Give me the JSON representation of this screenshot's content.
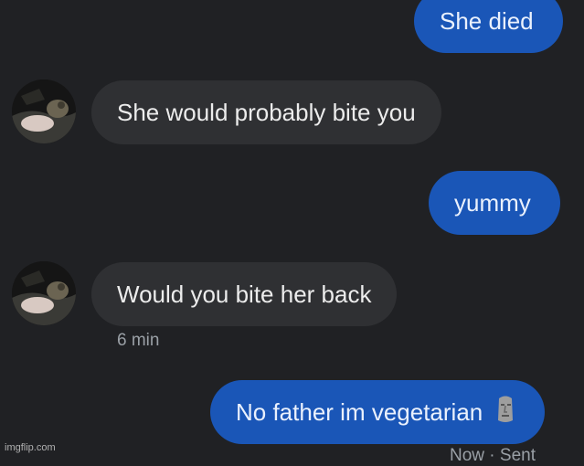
{
  "conversation": {
    "messages": [
      {
        "direction": "sent",
        "text": "She died"
      },
      {
        "direction": "received",
        "text": "She would probably bite you"
      },
      {
        "direction": "sent",
        "text": "yummy"
      },
      {
        "direction": "received",
        "text": "Would you bite her back",
        "timestamp": "6 min"
      },
      {
        "direction": "sent",
        "text": "No father im vegetarian",
        "emoji_icon": "moai-icon",
        "status": "Now · Sent"
      }
    ]
  },
  "colors": {
    "sent_bubble": "#1a56b7",
    "received_bubble": "#2f3033",
    "background": "#202124",
    "meta_text": "#9aa0a6"
  },
  "watermark": {
    "text": "imgflip.com"
  }
}
